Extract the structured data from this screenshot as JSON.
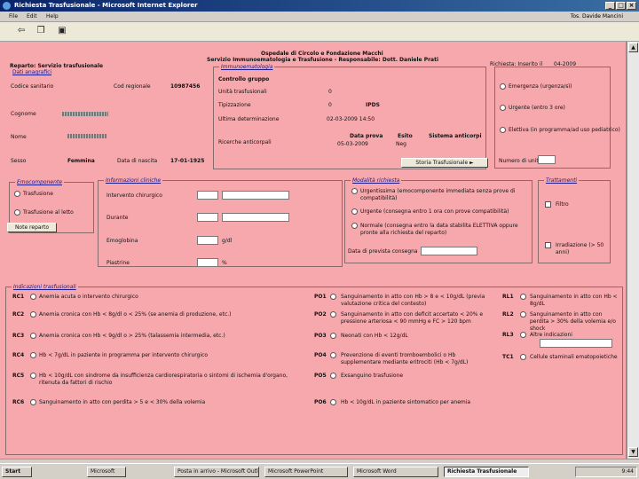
{
  "window": {
    "title": "Richiesta Trasfusionale - Microsoft Internet Explorer",
    "min": "_",
    "max": "□",
    "close": "×"
  },
  "menu": [
    "File",
    "Edit",
    "Help"
  ],
  "user": "Tos. Davide Mancini",
  "header": {
    "line1": "Ospedale di Circolo e Fondazione Macchi",
    "line2": "Servizio Immunoematologia e Trasfusione - Responsabile: Dott. Daniele Prati"
  },
  "left_info": {
    "reparto": "Reparto: Servizio trasfusionale",
    "dati": "Dati anagrafici",
    "codice_sanitario": "Codice sanitario",
    "cod_reg_label": "Cod regionale",
    "cod_reg_value": "10987456",
    "cognome": "Cognome",
    "nome": "Nome",
    "sesso": "Sesso",
    "sesso_value": "Femmina",
    "data_nascita_label": "Data di nascita",
    "data_nascita_value": "17-01-1925"
  },
  "richiesta": {
    "label": "Richiesta: Inserito il",
    "date": "04-2009"
  },
  "immuno": {
    "legend": "Immunoematologia",
    "controllo": "Controllo gruppo",
    "unita_label": "Unità trasfusionali",
    "unita_value": "0",
    "tipizzazione": "Tipizzazione",
    "tip_value": "0",
    "tip_value2": "IPDS",
    "ultima": "Ultima determinazione",
    "ultima_value": "02-03-2009 14:50",
    "ricerche": "Ricerche anticorpali",
    "col1": "Data prova",
    "col2": "Esito",
    "col3": "Sistema anticorpi",
    "row_date": "05-03-2009",
    "row_esito": "Neg",
    "storia_btn": "Storia Trasfusionale ►"
  },
  "right_opts": {
    "o1": "Emergenza (urgenza/sì)",
    "o2": "Urgente (entro 3 ore)",
    "o3": "Elettiva (in programma/ad uso pediatrico)",
    "numero_unita": "Numero di unità"
  },
  "emocomp": {
    "legend": "Emocomponente",
    "o1": "Trasfusione",
    "o2": "Trasfusione al letto",
    "btn": "Note reparto"
  },
  "lab": {
    "legend": "Informazioni cliniche",
    "r1": "Intervento chirurgico",
    "r2": "Durante",
    "r3": "Emoglobina",
    "r4": "Piastrine",
    "unit1": "g/dl",
    "unit2": "%"
  },
  "modalita": {
    "legend": "Modalità richiesta",
    "o1": "Urgentissima (emocomponente immediata senza prove di compatibilità)",
    "o2": "Urgente (consegna entro 1 ora con prove compatibilità)",
    "o3": "Normale (consegna entro la data stabilita ELETTIVA oppure pronte alla richiesta del reparto)",
    "data": "Data di prevista consegna"
  },
  "trattamenti": {
    "legend": "Trattamenti",
    "c1": "Filtro",
    "c2": "Irradiazione (> 50 anni)"
  },
  "indicazioni": {
    "legend": "Indicazioni trasfusionali",
    "rows": [
      {
        "code": "RC1",
        "text": "Anemia acuta o intervento chirurgico"
      },
      {
        "code": "RC2",
        "text": "Anemia cronica con Hb < 8g/dl o < 25% (se anemia di produzione, etc.)"
      },
      {
        "code": "RC3",
        "text": "Anemia cronica con Hb < 9g/dl o > 25% (talassemia intermedia, etc.)"
      },
      {
        "code": "RC4",
        "text": "Hb < 7g/dL in paziente in programma per intervento chirurgico"
      },
      {
        "code": "RC5",
        "text": "Hb < 10g/dL con sindrome da insufficienza cardiorespiratoria o sintomi di ischemia d'organo, ritenuta da fattori di rischio"
      },
      {
        "code": "RC6",
        "text": "Sanguinamento in atto con perdita > 5 e < 30% della volemia"
      }
    ],
    "rows_mid": [
      {
        "code": "PO1",
        "text": "Sanguinamento in atto con Hb > 8 e < 10g/dL (previa valutazione critica del contesto)"
      },
      {
        "code": "PO2",
        "text": "Sanguinamento in atto con deficit accertato < 20% e pressione arteriosa < 90 mmHg e FC > 120 bpm"
      },
      {
        "code": "PO3",
        "text": "Neonati con Hb < 12g/dL"
      },
      {
        "code": "PO4",
        "text": "Prevenzione di eventi tromboembolici o Hb supplementare mediante eritrociti (Hb < 7g/dL)"
      },
      {
        "code": "PO5",
        "text": "Exsanguino trasfusione"
      },
      {
        "code": "PO6",
        "text": "Hb < 10g/dL in paziente sintomatico per anemia"
      }
    ],
    "rows_right": [
      {
        "code": "RL1",
        "text": "Sanguinamento in atto con Hb < 8g/dL"
      },
      {
        "code": "RL2",
        "text": "Sanguinamento in atto con perdita > 30% della volemia e/o shock"
      },
      {
        "code": "RL3",
        "text": "Altre indicazioni"
      },
      {
        "code": "TC1",
        "text": "Cellule staminali ematopoietiche"
      }
    ]
  },
  "taskbar": {
    "start": "Start",
    "tasks": [
      "Microsoft",
      "Posta in arrivo - Microsoft Outlook",
      "Microsoft PowerPoint",
      "Microsoft Word",
      "Richiesta Trasfusionale"
    ],
    "time": "9:44"
  }
}
